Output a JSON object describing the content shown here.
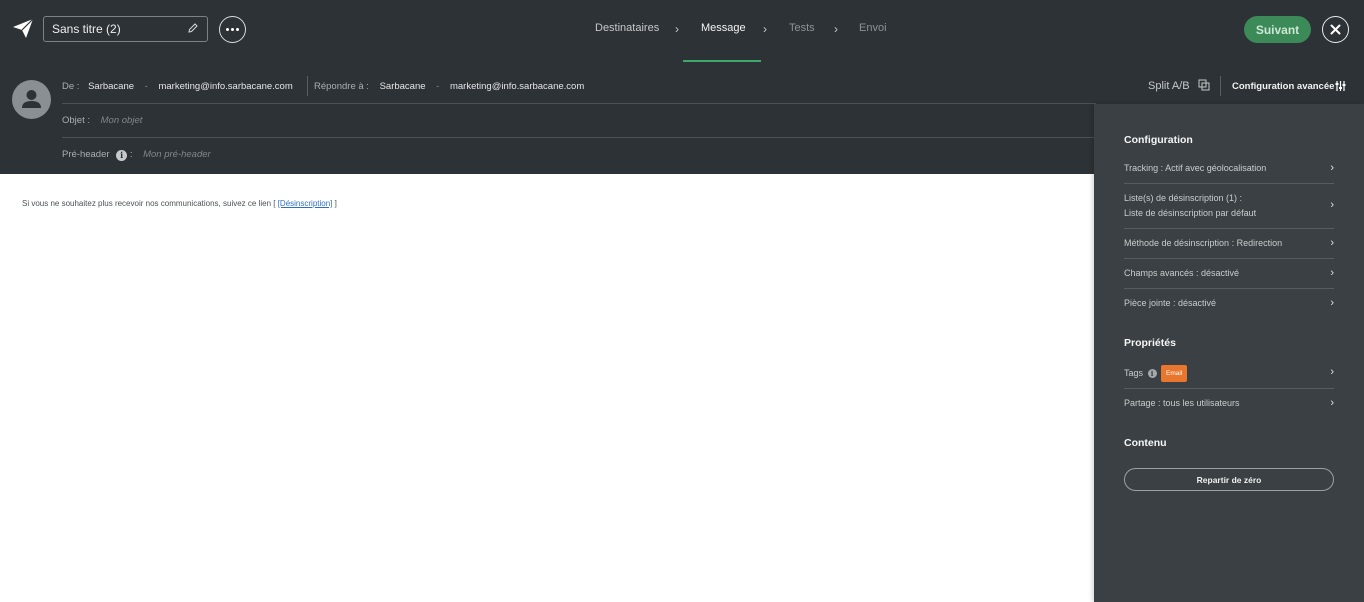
{
  "app": {
    "logo_icon": "paper-plane-icon",
    "campaign_title": "Sans titre (2)",
    "more_icon": "more-horizontal-icon"
  },
  "steps": [
    {
      "label": "Destinataires",
      "state": "done"
    },
    {
      "label": "Message",
      "state": "active"
    },
    {
      "label": "Tests",
      "state": "inactive"
    },
    {
      "label": "Envoi",
      "state": "inactive"
    }
  ],
  "actions": {
    "next_label": "Suivant",
    "next_color": "#3b8a58",
    "close_icon": "close-icon"
  },
  "header": {
    "from_label": "De :",
    "from_name": "Sarbacane",
    "from_email": "marketing@info.sarbacane.com",
    "reply_label": "Répondre à :",
    "reply_name": "Sarbacane",
    "reply_email": "marketing@info.sarbacane.com",
    "separator": "-",
    "subject_label": "Objet :",
    "subject_placeholder": "Mon objet",
    "preheader_label": "Pré-header",
    "preheader_colon": ":",
    "preheader_placeholder": "Mon pré-header",
    "split_label": "Split A/B",
    "advanced_label": "Configuration avancée"
  },
  "email": {
    "unsubscribe_text": "Si vous ne souhaitez plus recevoir nos communications, suivez ce lien [",
    "unsubscribe_link": "[Désinscription]",
    "unsubscribe_end": "]"
  },
  "panel": {
    "config_title": "Configuration",
    "config_items": [
      {
        "line1": "Tracking : Actif avec géolocalisation"
      },
      {
        "line1": "Liste(s) de désinscription (1) :",
        "line2": "Liste de désinscription par défaut"
      },
      {
        "line1": "Méthode de désinscription : Redirection"
      },
      {
        "line1": "Champs avancés : désactivé"
      },
      {
        "line1": "Pièce jointe : désactivé"
      }
    ],
    "props_title": "Propriétés",
    "tags_label": "Tags",
    "tag_value": "Email",
    "tag_color": "#e8762d",
    "share_label": "Partage : tous les utilisateurs",
    "content_title": "Contenu",
    "reset_label": "Repartir de zéro"
  }
}
